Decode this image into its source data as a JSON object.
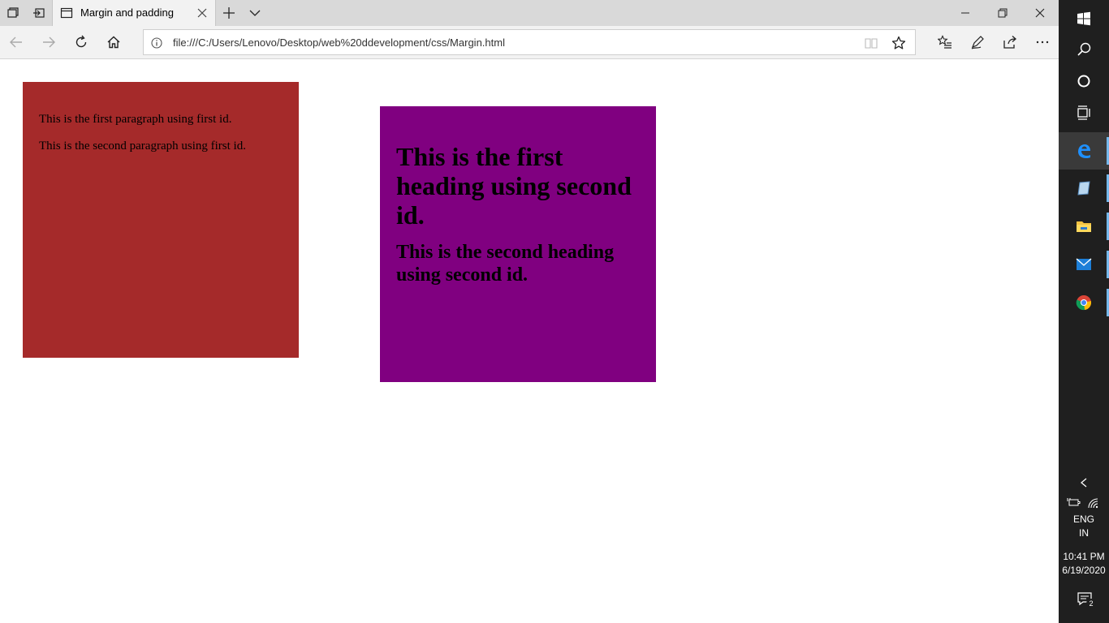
{
  "browser": {
    "tab": {
      "title": "Margin and padding"
    },
    "address": {
      "url": "file:///C:/Users/Lenovo/Desktop/web%20ddevelopment/css/Margin.html"
    }
  },
  "page": {
    "first_box": {
      "color": "#a52a2a",
      "paragraphs": [
        "This is the first paragraph using first id.",
        "This is the second paragraph using first id."
      ]
    },
    "second_box": {
      "color": "#800080",
      "heading1": "This is the first heading using second id.",
      "heading2": "This is the second heading using second id."
    }
  },
  "taskbar": {
    "apps": [
      "windows-start-icon",
      "search-icon",
      "cortana-icon",
      "task-view-icon",
      "edge-icon",
      "app-icon",
      "file-explorer-icon",
      "mail-icon",
      "chrome-icon"
    ],
    "language": {
      "line1": "ENG",
      "line2": "IN"
    },
    "clock": {
      "time": "10:41 PM",
      "date": "6/19/2020"
    },
    "notifications": {
      "count": "2"
    }
  }
}
